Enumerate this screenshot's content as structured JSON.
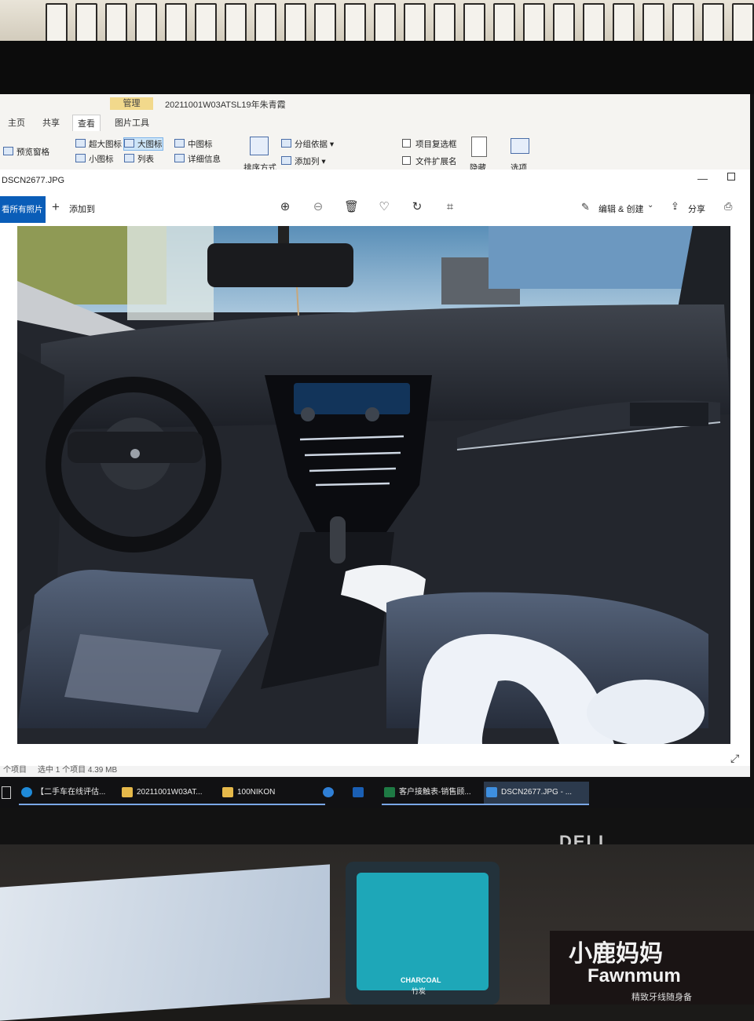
{
  "explorer": {
    "window_title": "20211001W03ATSL19年朱青霞",
    "context_tab": "管理",
    "tabs": [
      "主页",
      "共享",
      "查看",
      "图片工具"
    ],
    "active_tab": "查看",
    "preview_pane": "预览窗格",
    "layout_options": [
      "超大图标",
      "大图标",
      "中图标",
      "小图标",
      "列表",
      "详细信息"
    ],
    "selected_layout": "大图标",
    "sort_by": "排序方式",
    "group_by": "分组依据",
    "add_column": "添加列",
    "item_checkboxes": "项目复选框",
    "file_extensions": "文件扩展名",
    "hide": "隐藏",
    "options": "选项"
  },
  "viewer": {
    "file_name": "DSCN2677.JPG",
    "all_photos": "看所有照片",
    "add_to": "添加到",
    "edit_create": "编辑 & 创建",
    "share": "分享"
  },
  "status_bar": {
    "items": "个项目",
    "selected": "选中 1 个项目  4.39 MB"
  },
  "taskbar": {
    "tasks": [
      {
        "label": "【二手车在线评估...",
        "icon": "edge-icon",
        "color": "#1f8ad8"
      },
      {
        "label": "20211001W03AT...",
        "icon": "folder-icon",
        "color": "#e6b94a"
      },
      {
        "label": "100NIKON",
        "icon": "folder-icon",
        "color": "#e6b94a"
      },
      {
        "label": "",
        "icon": "ie-icon",
        "color": "#2f7fd6"
      },
      {
        "label": "",
        "icon": "outlook-icon",
        "color": "#1a5fb4"
      },
      {
        "label": "客户接触表-销售顾...",
        "icon": "excel-icon",
        "color": "#1e7a44"
      },
      {
        "label": "DSCN2677.JPG - ...",
        "icon": "photos-icon",
        "color": "#3e8fe0"
      }
    ]
  },
  "monitor": {
    "brand": "DELL"
  },
  "desk_items": {
    "floss_box_label": "CHARCOAL",
    "floss_box_sub": "竹炭",
    "brand_cn": "小鹿妈妈",
    "brand_en": "Fawnmum",
    "slogan": "精致牙线随身备"
  }
}
